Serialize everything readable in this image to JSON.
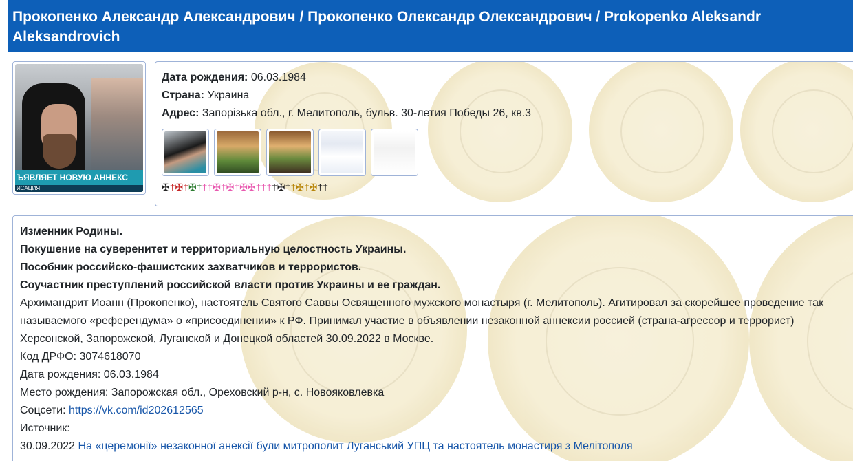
{
  "header": {
    "title": "Прокопенко Александр Александрович / Прокопенко Олександр Олександрович / Prokopenko Aleksandr Aleksandrovich"
  },
  "photo": {
    "ticker": "ЪЯВЛЯЕТ НОВУЮ АННЕКС",
    "ticker_sub": "ИСАЦИЯ"
  },
  "info": {
    "birth_label": "Дата рождения:",
    "birth_value": "06.03.1984",
    "country_label": "Страна:",
    "country_value": "Украина",
    "address_label": "Адрес:",
    "address_value": "Запорізька обл., г. Мелитополь, бульв. 30-летия Победы 26, кв.3",
    "crosses": [
      {
        "glyph": "✠",
        "color": "#222222"
      },
      {
        "glyph": "†",
        "color": "#c62828"
      },
      {
        "glyph": "✠",
        "color": "#c62828"
      },
      {
        "glyph": "†",
        "color": "#c62828"
      },
      {
        "glyph": "✠",
        "color": "#2e7d32"
      },
      {
        "glyph": "†",
        "color": "#2e7d32"
      },
      {
        "glyph": "†",
        "color": "#e85ab0"
      },
      {
        "glyph": "†",
        "color": "#e85ab0"
      },
      {
        "glyph": "✠",
        "color": "#e85ab0"
      },
      {
        "glyph": "†",
        "color": "#e85ab0"
      },
      {
        "glyph": "✠",
        "color": "#e85ab0"
      },
      {
        "glyph": "†",
        "color": "#e85ab0"
      },
      {
        "glyph": "✠",
        "color": "#e85ab0"
      },
      {
        "glyph": "✠",
        "color": "#e85ab0"
      },
      {
        "glyph": "†",
        "color": "#e85ab0"
      },
      {
        "glyph": "†",
        "color": "#e85ab0"
      },
      {
        "glyph": "†",
        "color": "#e85ab0"
      },
      {
        "glyph": "†",
        "color": "#222222"
      },
      {
        "glyph": "✠",
        "color": "#222222"
      },
      {
        "glyph": "†",
        "color": "#222222"
      },
      {
        "glyph": "†",
        "color": "#b8860b"
      },
      {
        "glyph": "✠",
        "color": "#b8860b"
      },
      {
        "glyph": "†",
        "color": "#b8860b"
      },
      {
        "glyph": "✠",
        "color": "#b8860b"
      },
      {
        "glyph": "†",
        "color": "#222222"
      },
      {
        "glyph": "†",
        "color": "#222222"
      }
    ]
  },
  "bio": {
    "verdicts": [
      "Изменник Родины.",
      "Покушение на суверенитет и территориальную целостность Украины.",
      "Пособник российско-фашистских захватчиков и террористов.",
      "Соучастник преступлений российской власти против Украины и ее граждан."
    ],
    "description": "Архимандрит Иоанн (Прокопенко), настоятель Святого Саввы Освященного мужского монастыря (г. Мелитополь). Агитировал за скорейшее проведение так называемого «референдума» о «присоединении» к РФ. Принимал участие в объявлении незаконной аннексии россией (страна-агрессор и террорист) Херсонской, Запорожской, Луганской и Донецкой областей 30.09.2022 в Москве.",
    "drfo": "Код ДРФО: 3074618070",
    "birth": "Дата рождения: 06.03.1984",
    "birthplace": "Место рождения: Запорожская обл., Ореховский р-н, с. Новояковлевка",
    "social_label": "Соцсети: ",
    "social_link": "https://vk.com/id202612565",
    "source_label": "Источник:",
    "source_date": "30.09.2022 ",
    "source_link": "На «церемонії» незаконної анексії були митрополит Луганський УПЦ та настоятель монастиря з Мелітополя"
  }
}
